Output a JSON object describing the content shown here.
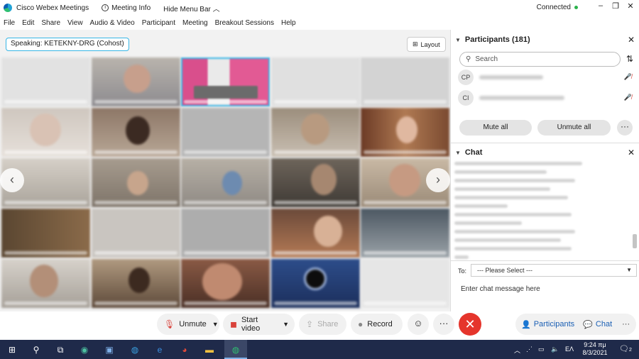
{
  "titlebar": {
    "app_name": "Cisco Webex Meetings",
    "meeting_info": "Meeting Info",
    "hide_menu": "Hide Menu Bar",
    "status": "Connected"
  },
  "menu": [
    "File",
    "Edit",
    "Share",
    "View",
    "Audio & Video",
    "Participant",
    "Meeting",
    "Breakout Sessions",
    "Help"
  ],
  "video": {
    "speaking_label": "Speaking: KETEKNY-DRG (Cohost)",
    "layout_label": "Layout"
  },
  "participants": {
    "header": "Participants (181)",
    "search_placeholder": "Search",
    "rows": [
      {
        "initials": "CP"
      },
      {
        "initials": "CI"
      }
    ],
    "mute_all": "Mute all",
    "unmute_all": "Unmute all"
  },
  "chat": {
    "header": "Chat",
    "to_label": "To:",
    "to_value": "--- Please Select ---",
    "input_placeholder": "Enter chat message here"
  },
  "controls": {
    "unmute": "Unmute",
    "start_video": "Start video",
    "share": "Share",
    "record": "Record",
    "participants": "Participants",
    "chat": "Chat"
  },
  "taskbar": {
    "language": "ΕΛ",
    "time": "9:24 πμ",
    "date": "8/3/2021",
    "notifications": "2"
  }
}
